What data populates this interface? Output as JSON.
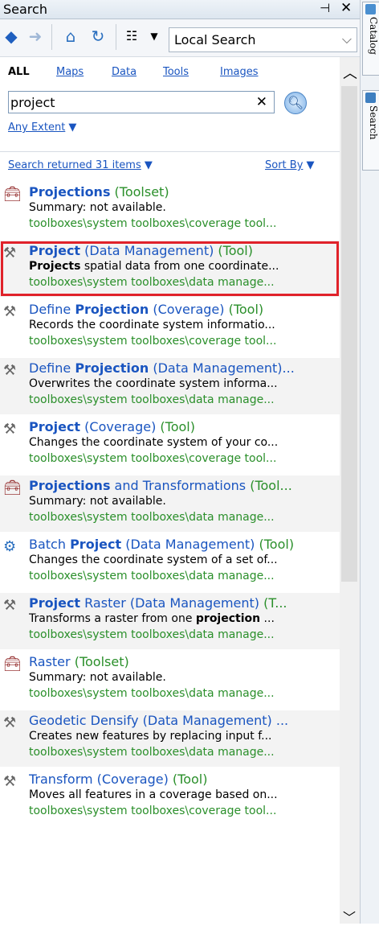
{
  "window": {
    "title": "Search",
    "pin_glyph": "⊣",
    "close_glyph": "✕"
  },
  "toolbar": {
    "location": "Local Search"
  },
  "side_tabs": [
    "Catalog",
    "Search"
  ],
  "types": {
    "all": "ALL",
    "maps": "Maps",
    "data": "Data",
    "tools": "Tools",
    "images": "Images"
  },
  "search": {
    "value": "project",
    "extent": "Any Extent"
  },
  "results": {
    "returned": "Search returned 31 items",
    "sort_by": "Sort By"
  },
  "items": [
    {
      "icon": "toolset-icon",
      "l1": "Projections (Toolset)",
      "l2": "Summary: not available.",
      "l3": "toolboxes\\system toolboxes\\coverage tool..."
    },
    {
      "icon": "tool-icon",
      "l1": "Project (Data Management) (Tool)",
      "l2": "Projects spatial data from one coordinate...",
      "l3": "toolboxes\\system toolboxes\\data manage..."
    },
    {
      "icon": "tool-icon",
      "l1": "Define Projection (Coverage) (Tool)",
      "l2": "Records the coordinate system informatio...",
      "l3": "toolboxes\\system toolboxes\\coverage tool..."
    },
    {
      "icon": "tool-icon",
      "l1": "Define Projection (Data Management)...",
      "l2": "Overwrites the coordinate system informa...",
      "l3": "toolboxes\\system toolboxes\\data manage..."
    },
    {
      "icon": "tool-icon",
      "l1": "Project (Coverage) (Tool)",
      "l2": "Changes the coordinate system of your co...",
      "l3": "toolboxes\\system toolboxes\\coverage tool..."
    },
    {
      "icon": "toolset-icon",
      "l1": "Projections and Transformations (Tool...",
      "l2": "Summary: not available.",
      "l3": "toolboxes\\system toolboxes\\data manage..."
    },
    {
      "icon": "script-tool-icon",
      "l1": "Batch Project (Data Management) (Tool)",
      "l2": "Changes the coordinate system of a set of...",
      "l3": "toolboxes\\system toolboxes\\data manage..."
    },
    {
      "icon": "tool-icon",
      "l1": "Project Raster (Data Management) (T...",
      "l2": "Transforms a raster from one projection ...",
      "l3": "toolboxes\\system toolboxes\\data manage..."
    },
    {
      "icon": "toolset-icon",
      "l1": "Raster (Toolset)",
      "l2": "Summary: not available.",
      "l3": "toolboxes\\system toolboxes\\data manage..."
    },
    {
      "icon": "tool-icon",
      "l1": "Geodetic Densify (Data Management) ...",
      "l2": "Creates new features by replacing input f...",
      "l3": "toolboxes\\system toolboxes\\data manage..."
    },
    {
      "icon": "tool-icon",
      "l1": "Transform (Coverage) (Tool)",
      "l2": "Moves all features in a coverage based on...",
      "l3": "toolboxes\\system toolboxes\\coverage tool..."
    }
  ]
}
